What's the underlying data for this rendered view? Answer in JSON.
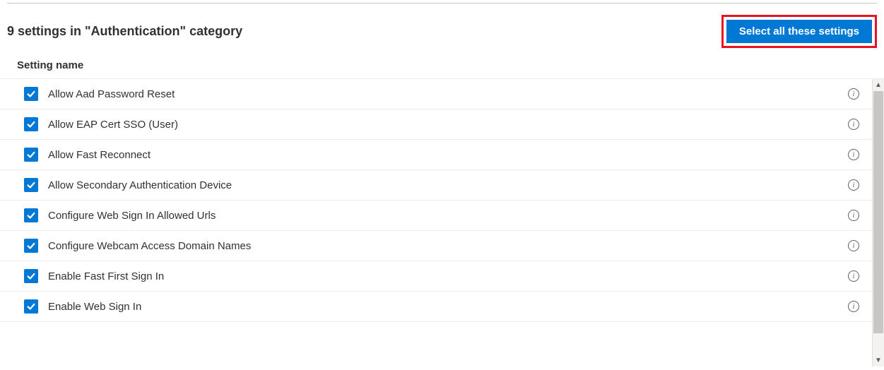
{
  "header": {
    "category_title": "9 settings in \"Authentication\" category",
    "select_all_label": "Select all these settings"
  },
  "column_header": "Setting name",
  "settings": [
    {
      "label": "Allow Aad Password Reset",
      "checked": true
    },
    {
      "label": "Allow EAP Cert SSO (User)",
      "checked": true
    },
    {
      "label": "Allow Fast Reconnect",
      "checked": true
    },
    {
      "label": "Allow Secondary Authentication Device",
      "checked": true
    },
    {
      "label": "Configure Web Sign In Allowed Urls",
      "checked": true
    },
    {
      "label": "Configure Webcam Access Domain Names",
      "checked": true
    },
    {
      "label": "Enable Fast First Sign In",
      "checked": true
    },
    {
      "label": "Enable Web Sign In",
      "checked": true
    }
  ]
}
